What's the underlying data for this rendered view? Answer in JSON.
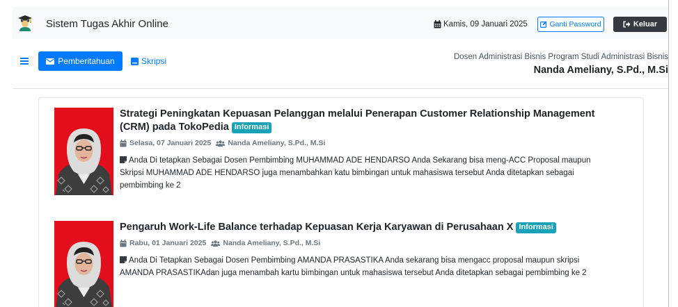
{
  "app": {
    "title": "Sistem Tugas Akhir Online",
    "logo_icon": "graduation-cap-icon"
  },
  "header": {
    "date_icon": "calendar-icon",
    "date": "Kamis, 09 Januari 2025",
    "change_password": {
      "label": "Ganti Password",
      "icon": "edit-icon"
    },
    "logout": {
      "label": "Keluar",
      "icon": "sign-out-icon"
    }
  },
  "nav": {
    "menu_icon": "bars-icon",
    "items": [
      {
        "label": "Pemberitahuan",
        "icon": "envelope-icon",
        "active": true
      },
      {
        "label": "Skripsi",
        "icon": "book-icon",
        "active": false
      }
    ]
  },
  "user": {
    "role": "Dosen Administrasi Bisnis Program Studi Administrasi Bisnis",
    "name": "Nanda Ameliany, S.Pd., M.Si"
  },
  "notifications": [
    {
      "title": "Strategi Peningkatan Kepuasan Pelanggan melalui Penerapan Customer Relationship Management (CRM) pada TokoPedia",
      "badge": "Informasi",
      "date_icon": "calendar-icon",
      "date": "Selasa, 07 Januari 2025",
      "author_icon": "users-icon",
      "author": "Nanda Ameliany, S.Pd., M.Si",
      "message_icon": "sticky-note-icon",
      "message": "Anda Di tetapkan Sebagai Dosen Pembimbing MUHAMMAD ADE HENDARSO Anda Sekarang bisa meng-ACC Proposal maupun Skripsi MUHAMMAD ADE HENDARSO juga menambahkan katu bimbingan untuk mahasiswa tersebut Anda ditetapkan sebagai pembimbing ke 2"
    },
    {
      "title": "Pengaruh Work-Life Balance terhadap Kepuasan Kerja Karyawan di Perusahaan X",
      "badge": "Informasi",
      "date_icon": "calendar-icon",
      "date": "Rabu, 01 Januari 2025",
      "author_icon": "users-icon",
      "author": "Nanda Ameliany, S.Pd., M.Si",
      "message_icon": "sticky-note-icon",
      "message": "Anda Di Tetapkan Sebagai Dosen Pembimbing AMANDA PRASASTIKA Anda sekarang bisa mengacc proposal maupun skripsi AMANDA PRASASTIKAdan juga menambah kartu bimbingan untuk mahasiswa tersebut Anda ditetapkan sebagai pembimbing ke 2"
    }
  ],
  "colors": {
    "primary": "#007bff",
    "info_badge": "#17a2b8",
    "dark_button": "#343a40",
    "header_background": "#f8f9fa",
    "photo_background": "#e30e1c"
  }
}
